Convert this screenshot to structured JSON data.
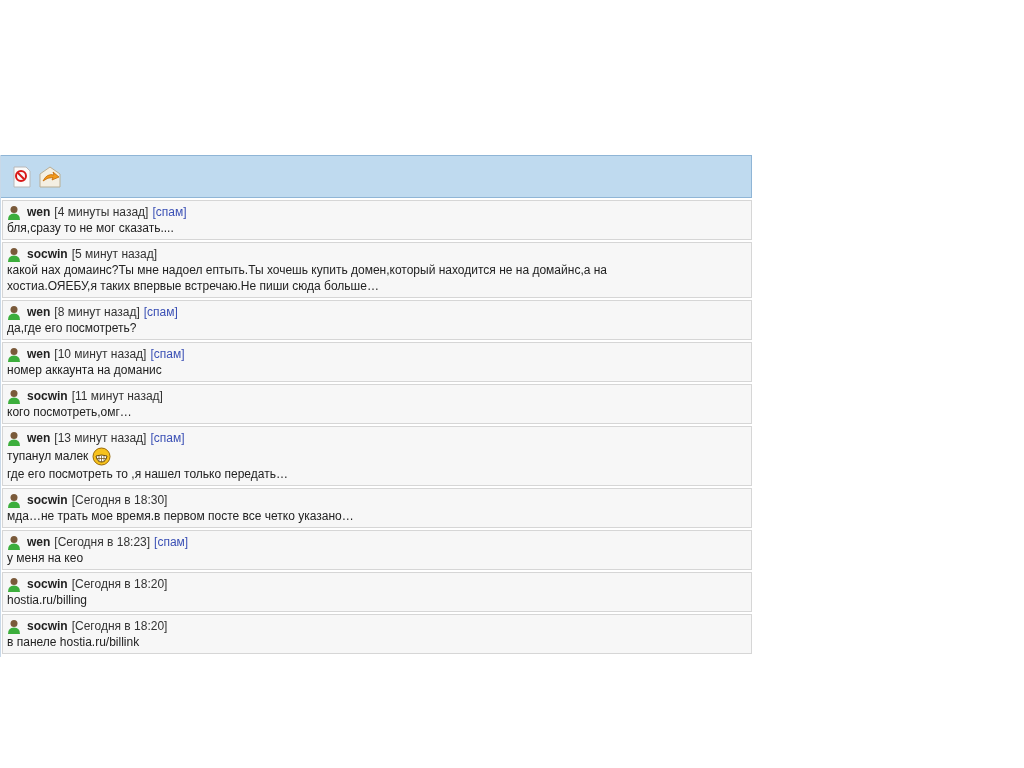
{
  "toolbar": {
    "buttons": [
      {
        "kind": "block"
      },
      {
        "kind": "refresh"
      }
    ]
  },
  "messages": [
    {
      "user": "wen",
      "time": "[4 минуты назад]",
      "spam_link": "[спам]",
      "lines": [
        {
          "text": "бля,сразу то не мог сказать....",
          "emoticon": false
        }
      ]
    },
    {
      "user": "socwin",
      "time": "[5 минут назад]",
      "lines": [
        {
          "text": "какой нах домаинс?Ты мне надоел ептыть.Ты хочешь купить домен,который находится не на домайнс,а на",
          "emoticon": false
        },
        {
          "text": "хостиа.ОЯЕБУ,я таких впервые встречаю.Не пиши сюда больше…",
          "emoticon": false
        }
      ]
    },
    {
      "user": "wen",
      "time": "[8 минут назад]",
      "spam_link": "[спам]",
      "lines": [
        {
          "text": "да,где его посмотреть?",
          "emoticon": false
        }
      ]
    },
    {
      "user": "wen",
      "time": "[10 минут назад]",
      "spam_link": "[спам]",
      "lines": [
        {
          "text": "номер аккаунта на доманис",
          "emoticon": false
        }
      ]
    },
    {
      "user": "socwin",
      "time": "[11 минут назад]",
      "lines": [
        {
          "text": "кого посмотреть,омг…",
          "emoticon": false
        }
      ]
    },
    {
      "user": "wen",
      "time": "[13 минут назад]",
      "spam_link": "[спам]",
      "lines": [
        {
          "text": "тупанул малек",
          "emoticon": true
        },
        {
          "text": "где его посмотреть то ,я нашел только передать…",
          "emoticon": false
        }
      ]
    },
    {
      "user": "socwin",
      "time": "[Сегодня в 18:30]",
      "lines": [
        {
          "text": "мда…не трать мое время.в первом посте все четко указано…",
          "emoticon": false
        }
      ]
    },
    {
      "user": "wen",
      "time": "[Сегодня в 18:23]",
      "spam_link": "[спам]",
      "lines": [
        {
          "text": "у меня на кео",
          "emoticon": false
        }
      ]
    },
    {
      "user": "socwin",
      "time": "[Сегодня в 18:20]",
      "lines": [
        {
          "text": "hostia.ru/billing",
          "emoticon": false
        }
      ]
    },
    {
      "user": "socwin",
      "time": "[Сегодня в 18:20]",
      "lines": [
        {
          "text": "в панеле hostia.ru/billink",
          "emoticon": false
        }
      ]
    }
  ]
}
